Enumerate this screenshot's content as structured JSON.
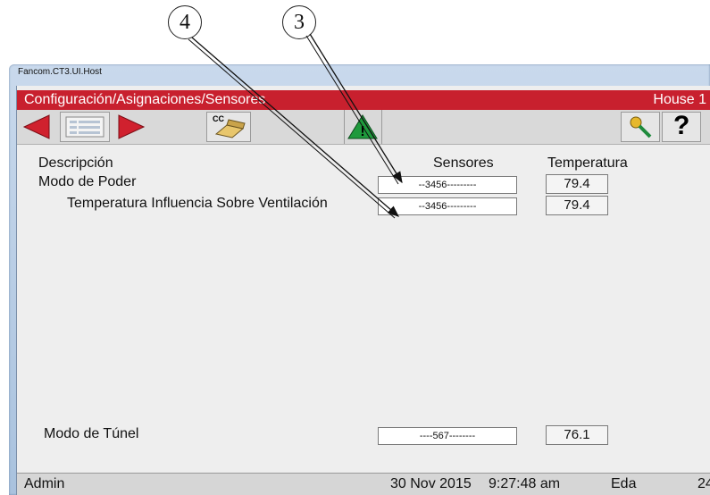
{
  "window": {
    "title": "Fancom.CT3.UI.Host"
  },
  "header": {
    "path": "Configuración/Asignaciones/Sensores",
    "house": "House 1"
  },
  "toolbar": {
    "cc_label": "CC",
    "help_label": "?"
  },
  "columns": {
    "description": "Descripción",
    "sensors": "Sensores",
    "temperature": "Temperatura"
  },
  "rows": [
    {
      "label": "Modo de Poder",
      "sensor": "--3456---------",
      "temp": "79.4"
    },
    {
      "label": "Temperatura Influencia Sobre Ventilación",
      "sensor": "--3456---------",
      "temp": "79.4"
    },
    {
      "label": "Modo de Túnel",
      "sensor": "----567--------",
      "temp": "76.1"
    }
  ],
  "status": {
    "user": "Admin",
    "date": "30 Nov 2015",
    "time": "9:27:48 am",
    "mode": "Eda",
    "day": "24"
  },
  "callouts": [
    {
      "label": "4"
    },
    {
      "label": "3"
    }
  ],
  "colors": {
    "header_red": "#c8202e",
    "arrow_red": "#d0212e",
    "warning_green": "#1e9a3c"
  }
}
